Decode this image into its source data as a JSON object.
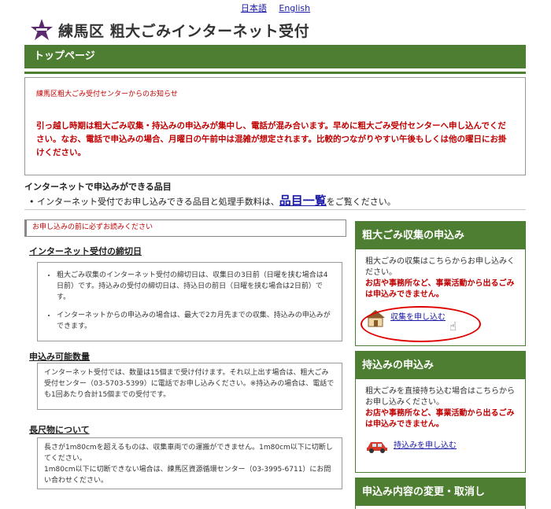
{
  "lang": {
    "ja": "日本語",
    "en": "English"
  },
  "header": {
    "title": "練馬区 粗大ごみインターネット受付",
    "logo": "nerima-star-logo"
  },
  "topbar": {
    "label": "トップページ"
  },
  "notice": {
    "title": "練馬区粗大ごみ受付センターからのお知らせ",
    "body": "引っ越し時期は粗大ごみ収集・持込みの申込みが集中し、電話が混み合います。早めに粗大ごみ受付センターへ申し込んでください。なお、電話で申込みの場合、月曜日の午前中は混雑が想定されます。比較的つながりやすい午後もしくは他の曜日にお掛けください。"
  },
  "items": {
    "heading": "インターネットで申込みができる品目",
    "text_before": "インターネット受付でお申し込みできる品目と処理手数料は、",
    "link": "品目一覧",
    "text_after": "をご覧ください。"
  },
  "alert": {
    "text": "お申し込みの前に必ずお読みください"
  },
  "deadline": {
    "heading": "インターネット受付の締切日",
    "items": [
      "粗大ごみ収集のインターネット受付の締切日は、収集日の3日前（日曜を挟む場合は4日前）です。持込みの受付の締切日は、持込日の前日（日曜を挟む場合は2日前）です。",
      "インターネットからの申込みの場合は、最大で2カ月先までの収集、持込みの申込みができます。"
    ]
  },
  "quantity": {
    "heading": "申込み可能数量",
    "text": "インターネット受付では、数量は15個まで受け付けます。それ以上出す場合は、粗大ごみ受付センター（03-5703-5399）に電話でお申し込みください。※持込みの場合は、電話でも1回あたり合計15個までの受付です。"
  },
  "long": {
    "heading": "長尺物について",
    "line1": "長さが1m80cmを超えるものは、収集車両での運搬ができません。1m80cm以下に切断してください。",
    "line2": "1m80cm以下に切断できない場合は、練馬区資源循環センター（03-3995-6711）にお問い合わせください。"
  },
  "side_collect": {
    "heading": "粗大ごみ収集の申込み",
    "text": "粗大ごみの収集はこちらからお申し込みください。",
    "warn": "お店や事務所など、事業活動から出るごみは申込みできません。",
    "link": "収集を申し込む",
    "icon": "house-icon"
  },
  "side_bring": {
    "heading": "持込みの申込み",
    "text": "粗大ごみを直接持ち込む場合はこちらからお申し込みください。",
    "warn": "お店や事務所など、事業活動から出るごみは申込みできません。",
    "link": "持込みを申し込む",
    "icon": "car-icon"
  },
  "side_change": {
    "heading": "申込み内容の変更・取消し"
  },
  "colors": {
    "green": "#4e7e32",
    "red": "#c00000",
    "link": "#1a1aa6"
  }
}
